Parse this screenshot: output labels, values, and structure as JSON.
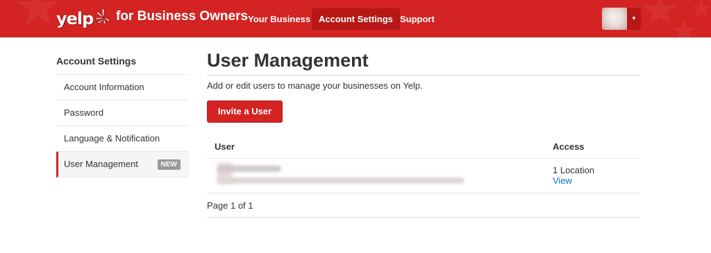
{
  "header": {
    "logo_text": "yelp",
    "subtitle": "for Business Owners",
    "nav": [
      "Your Business",
      "Account Settings",
      "Support"
    ],
    "active_nav": "Account Settings",
    "brand_color": "#d32323",
    "active_nav_color": "#b81717"
  },
  "sidebar": {
    "title": "Account Settings",
    "items": [
      {
        "label": "Account Information"
      },
      {
        "label": "Password"
      },
      {
        "label": "Language & Notification"
      },
      {
        "label": "User Management",
        "badge": "NEW",
        "active": true
      }
    ]
  },
  "main": {
    "title": "User Management",
    "description": "Add or edit users to manage your businesses on Yelp.",
    "invite_button": "Invite a User",
    "table": {
      "headers": [
        "User",
        "Access"
      ],
      "rows": [
        {
          "access": "1 Location",
          "link": "View"
        }
      ]
    },
    "pagination": "Page 1 of 1"
  },
  "icons": {
    "logo_burst": "yelp-burst-icon",
    "account_caret": "caret-down-icon"
  }
}
